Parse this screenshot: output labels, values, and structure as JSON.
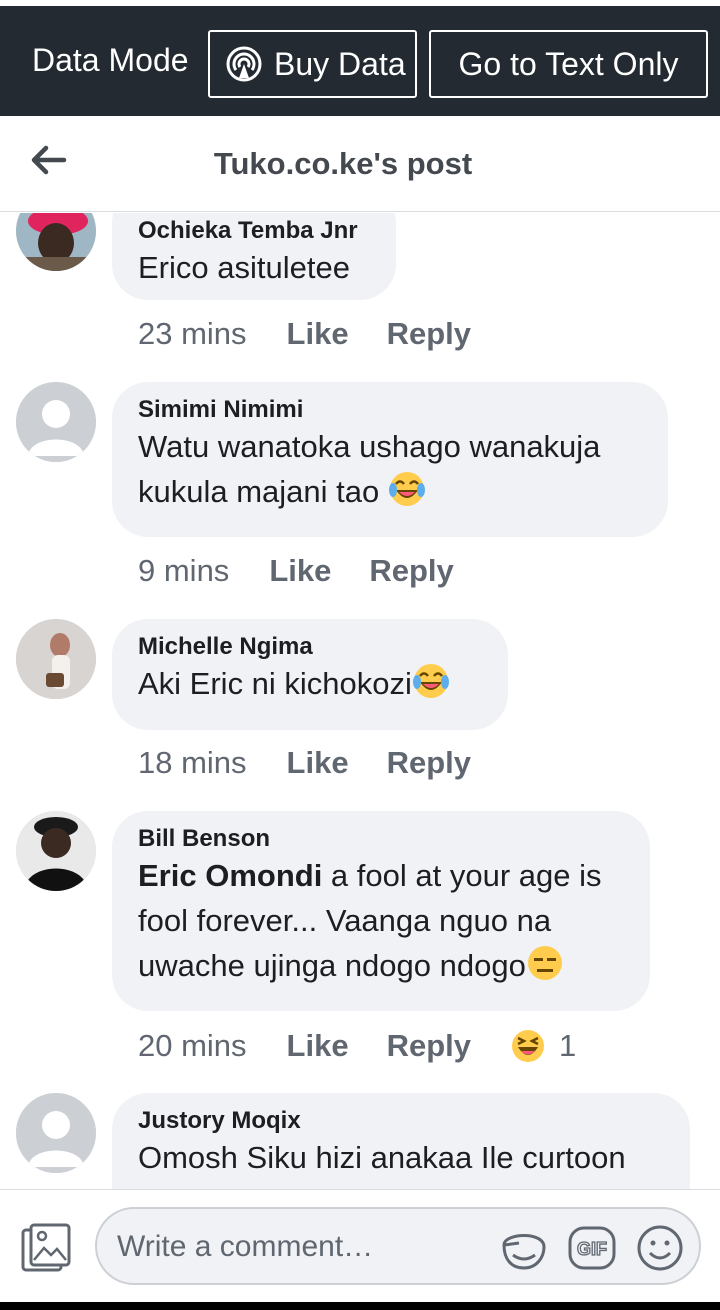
{
  "topbar": {
    "data_mode_label": "Data Mode",
    "buy_data_label": "Buy Data",
    "text_only_label": "Go to Text Only"
  },
  "header": {
    "title": "Tuko.co.ke's post"
  },
  "comments": [
    {
      "author": "Ochieka Temba Jnr",
      "text": "Erico asituletee",
      "time": "23 mins",
      "like": "Like",
      "reply": "Reply"
    },
    {
      "author": "Simimi Nimimi",
      "text_line1": "Watu wanatoka ushago wanakuja",
      "text_line2": "kukula majani tao",
      "emoji": "laughing-tears",
      "time": "9 mins",
      "like": "Like",
      "reply": "Reply"
    },
    {
      "author": "Michelle Ngima",
      "text": "Aki Eric ni kichokozi",
      "emoji": "laughing-tears",
      "time": "18 mins",
      "like": "Like",
      "reply": "Reply"
    },
    {
      "author": "Bill Benson",
      "mention": "Eric Omondi",
      "text_line1": " a fool at your age is",
      "text_line2": "fool forever... Vaanga nguo na",
      "text_line3": "uwache ujinga ndogo ndogo",
      "emoji": "expressionless",
      "time": "20 mins",
      "like": "Like",
      "reply": "Reply",
      "reaction": "haha",
      "reaction_count": "1"
    },
    {
      "author": "Justory Moqix",
      "text": "Omosh Siku hizi anakaa Ile curtoon"
    }
  ],
  "composer": {
    "placeholder": "Write a comment…",
    "icons": [
      "photo-icon",
      "sticker-icon",
      "gif-icon",
      "emoji-icon"
    ]
  },
  "colors": {
    "topbar_bg": "#232a31",
    "bubble_bg": "#f0f2f5",
    "meta_text": "#606770"
  }
}
